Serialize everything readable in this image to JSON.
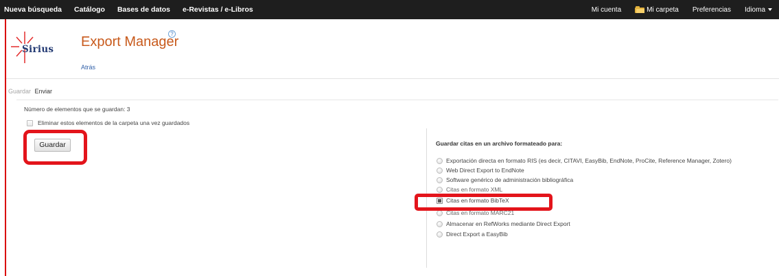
{
  "topnav": {
    "left": [
      "Nueva búsqueda",
      "Catálogo",
      "Bases de datos",
      "e-Revistas / e-Libros"
    ],
    "my_account": "Mi cuenta",
    "my_folder": "Mi carpeta",
    "preferences": "Preferencias",
    "language": "Idioma"
  },
  "header": {
    "logo_text": "Sirius",
    "title": "Export Manager",
    "help": "?",
    "back": "Atrás"
  },
  "crumbs": {
    "save": "Guardar",
    "send": "Enviar"
  },
  "save_panel": {
    "count_text": "Número de elementos que se guardan: 3",
    "remove_label": "Eliminar estos elementos de la carpeta una vez guardados",
    "save_button": "Guardar"
  },
  "format_panel": {
    "title": "Guardar citas en un archivo formateado para:",
    "options": [
      "Exportación directa en formato RIS (es decir, CITAVI, EasyBib, EndNote, ProCite, Reference Manager, Zotero)",
      "Web Direct Export to EndNote",
      "Software genérico de administración bibliográfica",
      "Citas en formato XML",
      "Citas en formato BibTeX",
      "Citas en formato MARC21",
      "Almacenar en RefWorks mediante Direct Export",
      "Direct Export a EasyBib"
    ],
    "selected_index": 4
  },
  "colors": {
    "topbar": "#1e1e1e",
    "title": "#c85a1c",
    "link": "#2f5fa8",
    "highlight": "#e3141b"
  }
}
